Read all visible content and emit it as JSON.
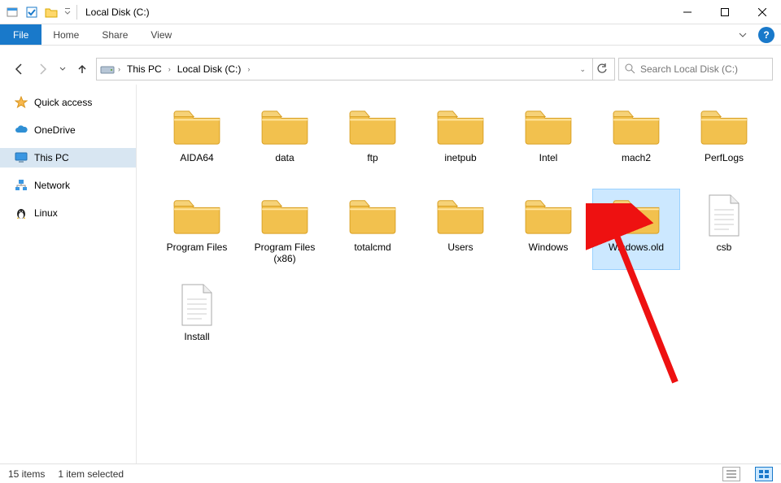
{
  "window": {
    "title": "Local Disk (C:)"
  },
  "ribbon": {
    "file": "File",
    "tabs": [
      "Home",
      "Share",
      "View"
    ]
  },
  "breadcrumb": {
    "segments": [
      "This PC",
      "Local Disk (C:)"
    ]
  },
  "search": {
    "placeholder": "Search Local Disk (C:)"
  },
  "sidebar": {
    "items": [
      {
        "label": "Quick access",
        "icon": "star",
        "selected": false
      },
      {
        "label": "OneDrive",
        "icon": "cloud",
        "selected": false
      },
      {
        "label": "This PC",
        "icon": "monitor",
        "selected": true
      },
      {
        "label": "Network",
        "icon": "network",
        "selected": false
      },
      {
        "label": "Linux",
        "icon": "penguin",
        "selected": false
      }
    ]
  },
  "items": [
    {
      "name": "AIDA64",
      "type": "folder",
      "selected": false
    },
    {
      "name": "data",
      "type": "folder",
      "selected": false
    },
    {
      "name": "ftp",
      "type": "folder",
      "selected": false
    },
    {
      "name": "inetpub",
      "type": "folder",
      "selected": false
    },
    {
      "name": "Intel",
      "type": "folder",
      "selected": false
    },
    {
      "name": "mach2",
      "type": "folder",
      "selected": false
    },
    {
      "name": "PerfLogs",
      "type": "folder",
      "selected": false
    },
    {
      "name": "Program Files",
      "type": "folder",
      "selected": false
    },
    {
      "name": "Program Files (x86)",
      "type": "folder",
      "selected": false
    },
    {
      "name": "totalcmd",
      "type": "folder",
      "selected": false
    },
    {
      "name": "Users",
      "type": "folder",
      "selected": false
    },
    {
      "name": "Windows",
      "type": "folder",
      "selected": false
    },
    {
      "name": "Windows.old",
      "type": "folder",
      "selected": true
    },
    {
      "name": "csb",
      "type": "file",
      "selected": false
    },
    {
      "name": "Install",
      "type": "file",
      "selected": false
    }
  ],
  "status": {
    "count": "15 items",
    "selection": "1 item selected"
  }
}
